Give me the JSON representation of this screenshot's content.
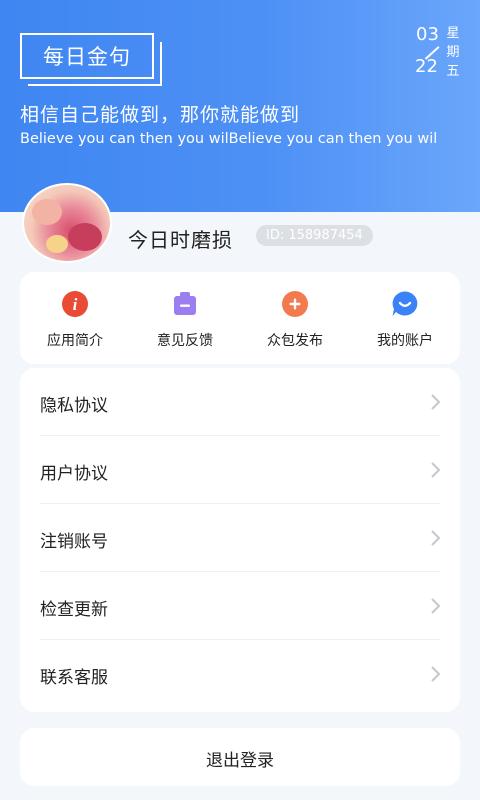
{
  "header": {
    "quote_title": "每日金句",
    "date": {
      "day": "03",
      "month": "22",
      "weekday_chars": [
        "星",
        "期",
        "五"
      ]
    },
    "quote_cn": "相信自己能做到，那你就能做到",
    "quote_en": "Believe you can then you wilBelieve you can then you wil"
  },
  "profile": {
    "username": "今日时磨损",
    "user_id": "ID: 158987454"
  },
  "shortcuts": [
    {
      "label": "应用简介",
      "icon": "info-icon",
      "color": "#e94b35"
    },
    {
      "label": "意见反馈",
      "icon": "feedback-icon",
      "color": "#9b7ff0"
    },
    {
      "label": "众包发布",
      "icon": "plus-icon",
      "color": "#f37a4f"
    },
    {
      "label": "我的账户",
      "icon": "smile-chat-icon",
      "color": "#3b82f6"
    }
  ],
  "menu": {
    "items": [
      {
        "label": "隐私协议"
      },
      {
        "label": "用户协议"
      },
      {
        "label": "注销账号"
      },
      {
        "label": "检查更新"
      },
      {
        "label": "联系客服"
      }
    ]
  },
  "logout": {
    "label": "退出登录"
  },
  "colors": {
    "header_blue": "#4a8cf4",
    "page_bg": "#f3f6fb"
  }
}
